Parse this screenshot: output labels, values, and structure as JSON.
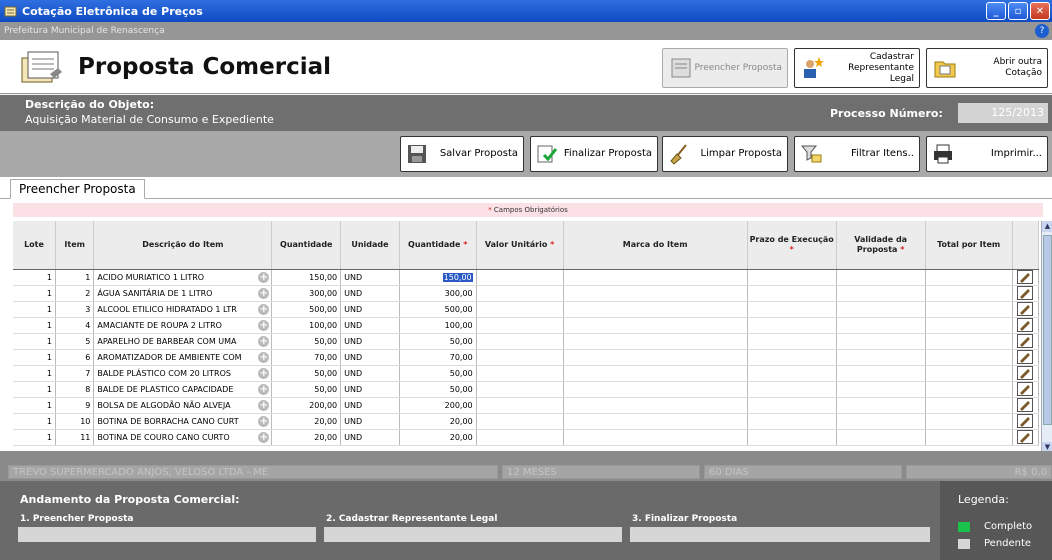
{
  "window": {
    "title": "Cotação Eletrônica de Preços",
    "subtitle": "Prefeitura Municipal de Renascença"
  },
  "header": {
    "title": "Proposta Comercial",
    "buttons": [
      {
        "label": "Preencher Proposta",
        "disabled": true
      },
      {
        "label": "Cadastrar Representante Legal",
        "disabled": false
      },
      {
        "label": "Abrir outra Cotação",
        "disabled": false
      }
    ]
  },
  "object": {
    "label": "Descrição do Objeto:",
    "value": "Aquisição Material de Consumo e Expediente",
    "process_label": "Processo Número:",
    "process_value": "125/2013"
  },
  "toolbar": {
    "save": "Salvar Proposta",
    "finalize": "Finalizar Proposta",
    "clear": "Limpar Proposta",
    "filter": "Filtrar Itens..",
    "print": "Imprimir..."
  },
  "tab": "Preencher Proposta",
  "required_note": "Campos Obrigatórios",
  "columns": [
    "Lote",
    "Item",
    "Descrição do Item",
    "Quantidade",
    "Unidade",
    "Quantidade",
    "Valor Unitário",
    "Marca do Item",
    "Prazo de Execução",
    "Validade da Proposta",
    "Total por Item"
  ],
  "rows": [
    {
      "lote": "1",
      "item": "1",
      "desc": "ACIDO MURIATICO 1 LITRO",
      "qty": "150,00",
      "unit": "UND",
      "qty2": "150,00",
      "selected": true
    },
    {
      "lote": "1",
      "item": "2",
      "desc": "ÁGUA SANITÁRIA DE 1 LITRO",
      "qty": "300,00",
      "unit": "UND",
      "qty2": "300,00"
    },
    {
      "lote": "1",
      "item": "3",
      "desc": "ALCOOL ETILICO HIDRATADO 1 LTR",
      "qty": "500,00",
      "unit": "UND",
      "qty2": "500,00"
    },
    {
      "lote": "1",
      "item": "4",
      "desc": "AMACIANTE DE ROUPA 2 LITRO",
      "qty": "100,00",
      "unit": "UND",
      "qty2": "100,00"
    },
    {
      "lote": "1",
      "item": "5",
      "desc": "APARELHO DE BARBEAR COM UMA",
      "qty": "50,00",
      "unit": "UND",
      "qty2": "50,00"
    },
    {
      "lote": "1",
      "item": "6",
      "desc": "AROMATIZADOR DE AMBIENTE COM",
      "qty": "70,00",
      "unit": "UND",
      "qty2": "70,00"
    },
    {
      "lote": "1",
      "item": "7",
      "desc": "BALDE PLÁSTICO COM 20 LITROS",
      "qty": "50,00",
      "unit": "UND",
      "qty2": "50,00"
    },
    {
      "lote": "1",
      "item": "8",
      "desc": "BALDE DE PLASTICO CAPACIDADE",
      "qty": "50,00",
      "unit": "UND",
      "qty2": "50,00"
    },
    {
      "lote": "1",
      "item": "9",
      "desc": "BOLSA DE ALGODÃO NÃO ALVEJA",
      "qty": "200,00",
      "unit": "UND",
      "qty2": "200,00"
    },
    {
      "lote": "1",
      "item": "10",
      "desc": "BOTINA DE BORRACHA CANO CURT",
      "qty": "20,00",
      "unit": "UND",
      "qty2": "20,00"
    },
    {
      "lote": "1",
      "item": "11",
      "desc": "BOTINA DE COURO CANO CURTO",
      "qty": "20,00",
      "unit": "UND",
      "qty2": "20,00"
    }
  ],
  "status": {
    "supplier": "TREVO SUPERMERCADO ANJOS, VELOSO LTDA - ME",
    "validity": "12 MESES",
    "days": "60 DIAS",
    "total": "R$ 0,0"
  },
  "progress": {
    "title": "Andamento da Proposta Comercial:",
    "steps": [
      "1. Preencher Proposta",
      "2. Cadastrar Representante Legal",
      "3. Finalizar Proposta"
    ],
    "legend_title": "Legenda:",
    "legend_complete": "Completo",
    "legend_pending": "Pendente",
    "color_complete": "#19c24a",
    "color_pending": "#d6d6d6"
  }
}
